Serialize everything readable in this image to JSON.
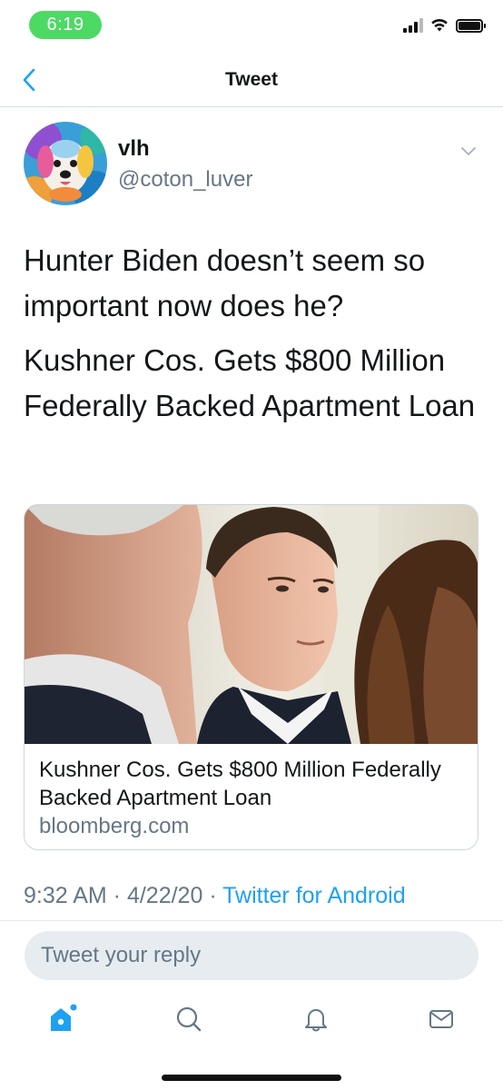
{
  "status_bar": {
    "time": "6:19"
  },
  "nav": {
    "title": "Tweet"
  },
  "author": {
    "name": "vlh",
    "handle": "@coton_luver"
  },
  "tweet": {
    "paragraphs": [
      "Hunter Biden doesn’t seem so important now does he?",
      "Kushner Cos. Gets $800 Million Federally Backed Apartment Loan"
    ]
  },
  "card": {
    "title": "Kushner Cos. Gets $800 Million Federally Backed Apartment Loan",
    "domain": "bloomberg.com"
  },
  "meta": {
    "time": "9:32 AM",
    "sep1": " · ",
    "date": "4/22/20",
    "sep2": " · ",
    "source": "Twitter for Android"
  },
  "reply": {
    "placeholder": "Tweet your reply"
  },
  "tabs": [
    {
      "icon": "home-icon"
    },
    {
      "icon": "search-icon"
    },
    {
      "icon": "notifications-bell-icon"
    },
    {
      "icon": "messages-envelope-icon"
    }
  ],
  "colors": {
    "accent": "#1da1f2",
    "secondary_text": "#657786",
    "time_pill": "#4cd964"
  }
}
